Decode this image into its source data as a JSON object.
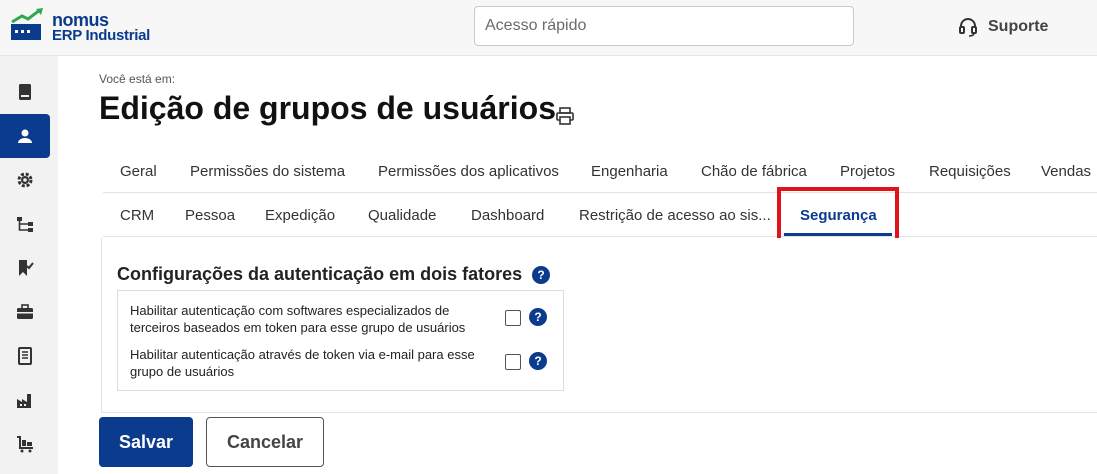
{
  "header": {
    "logo_line1": "nomus",
    "logo_line2": "ERP Industrial",
    "search_placeholder": "Acesso rápido",
    "support_label": "Suporte"
  },
  "sidebar": {
    "items": [
      {
        "icon": "book-icon"
      },
      {
        "icon": "user-icon",
        "active": true
      },
      {
        "icon": "gear-icon"
      },
      {
        "icon": "hierarchy-icon"
      },
      {
        "icon": "bookmark-check-icon"
      },
      {
        "icon": "briefcase-icon"
      },
      {
        "icon": "document-icon"
      },
      {
        "icon": "factory-icon"
      },
      {
        "icon": "cart-icon"
      }
    ]
  },
  "main": {
    "breadcrumb_label": "Você está em:",
    "title": "Edição de grupos de usuários",
    "tabs_row1": [
      "Geral",
      "Permissões do sistema",
      "Permissões dos aplicativos",
      "Engenharia",
      "Chão de fábrica",
      "Projetos",
      "Requisições",
      "Vendas"
    ],
    "tabs_row2": [
      "CRM",
      "Pessoa",
      "Expedição",
      "Qualidade",
      "Dashboard",
      "Restrição de acesso ao sis...",
      "Segurança"
    ],
    "selected_tab": "Segurança",
    "section_title": "Configurações da autenticação em dois fatores",
    "options": [
      {
        "label": "Habilitar autenticação com softwares especializados de terceiros baseados em token para esse grupo de usuários",
        "checked": false
      },
      {
        "label": "Habilitar autenticação através de token via e-mail para esse grupo de usuários",
        "checked": false
      }
    ],
    "help_symbol": "?",
    "save_label": "Salvar",
    "cancel_label": "Cancelar"
  },
  "colors": {
    "brand": "#0b3b8c",
    "highlight": "#e0121b"
  }
}
